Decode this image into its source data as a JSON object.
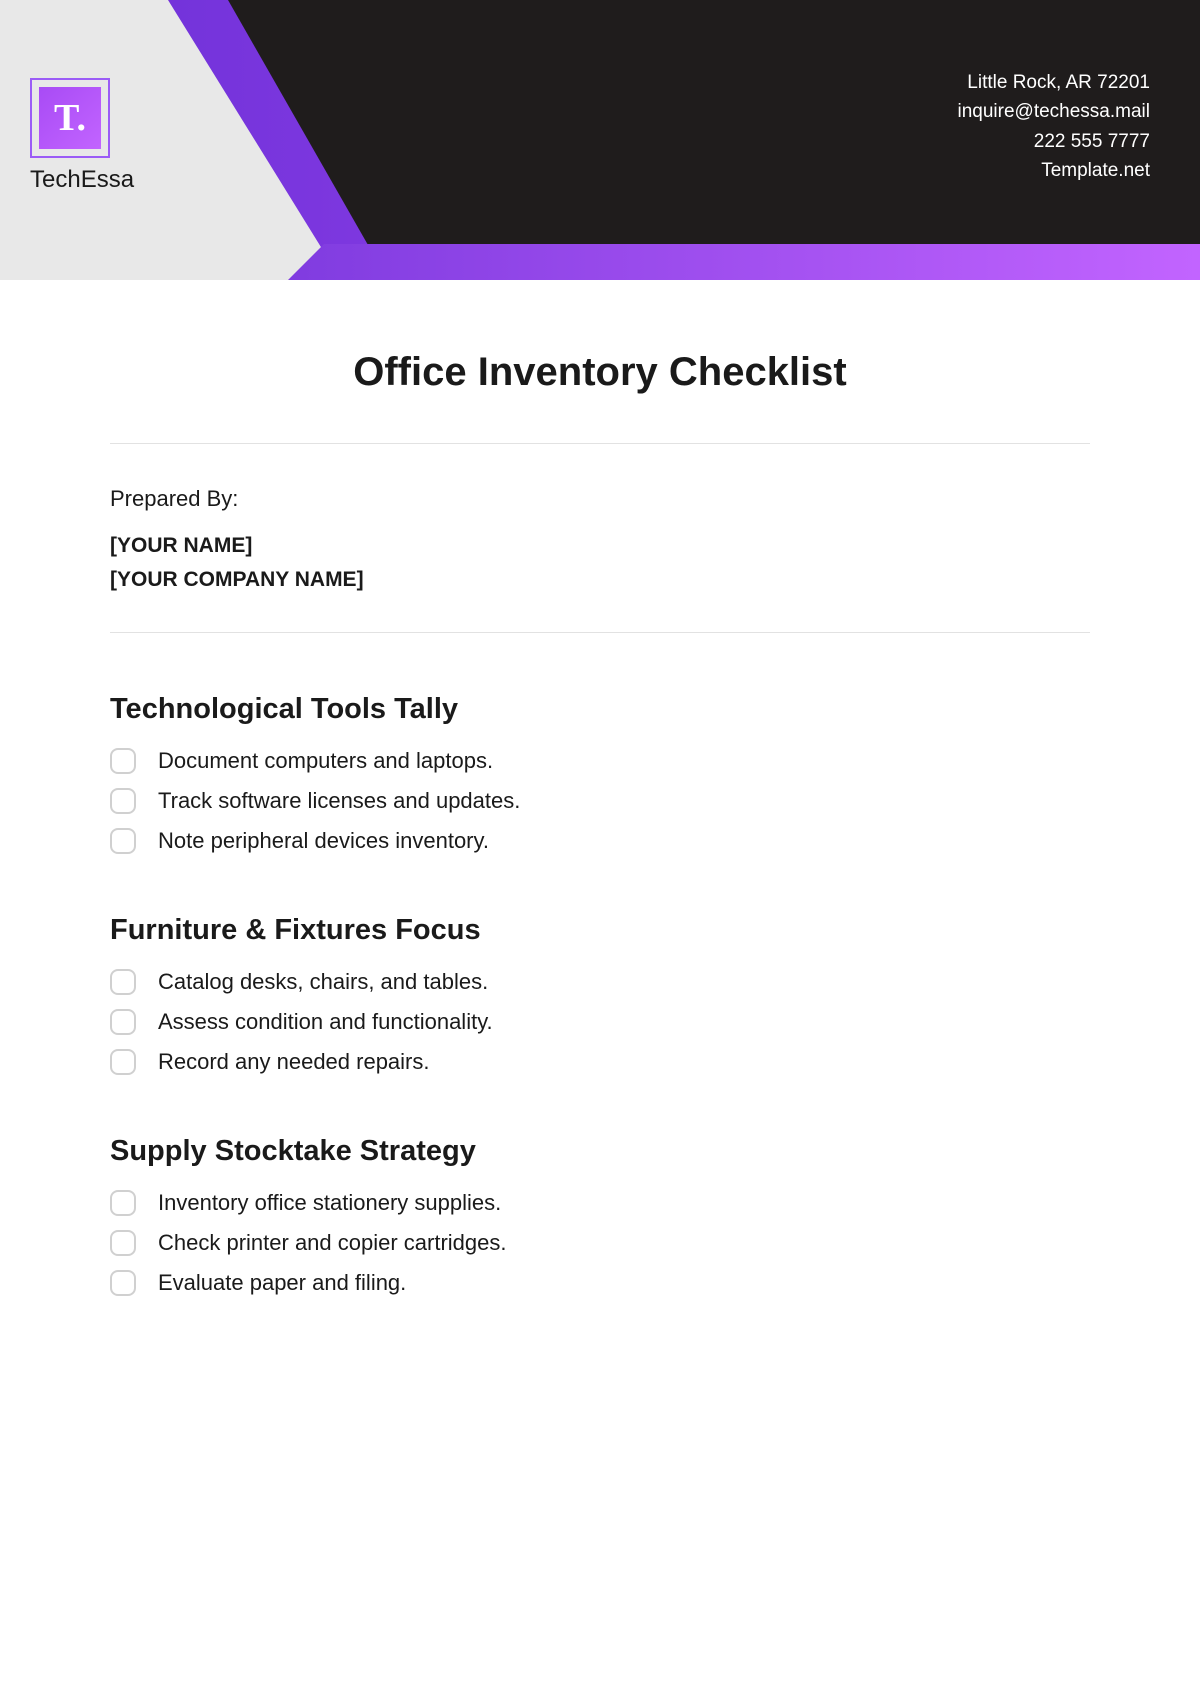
{
  "brand": "TechEssa",
  "logo_text": "T.",
  "contact": {
    "address": "Little Rock, AR 72201",
    "email": "inquire@techessa.mail",
    "phone": "222 555 7777",
    "site": "Template.net"
  },
  "title": "Office Inventory Checklist",
  "prepared_label": "Prepared By:",
  "prepared_name": "[YOUR NAME]",
  "prepared_company": "[YOUR COMPANY NAME]",
  "sections": [
    {
      "heading": "Technological Tools Tally",
      "items": [
        "Document computers and laptops.",
        "Track software licenses and updates.",
        "Note peripheral devices inventory."
      ]
    },
    {
      "heading": "Furniture & Fixtures Focus",
      "items": [
        "Catalog desks, chairs, and tables.",
        "Assess condition and functionality.",
        "Record any needed repairs."
      ]
    },
    {
      "heading": "Supply Stocktake Strategy",
      "items": [
        "Inventory office stationery supplies.",
        "Check printer and copier cartridges.",
        "Evaluate paper and filing."
      ]
    }
  ]
}
